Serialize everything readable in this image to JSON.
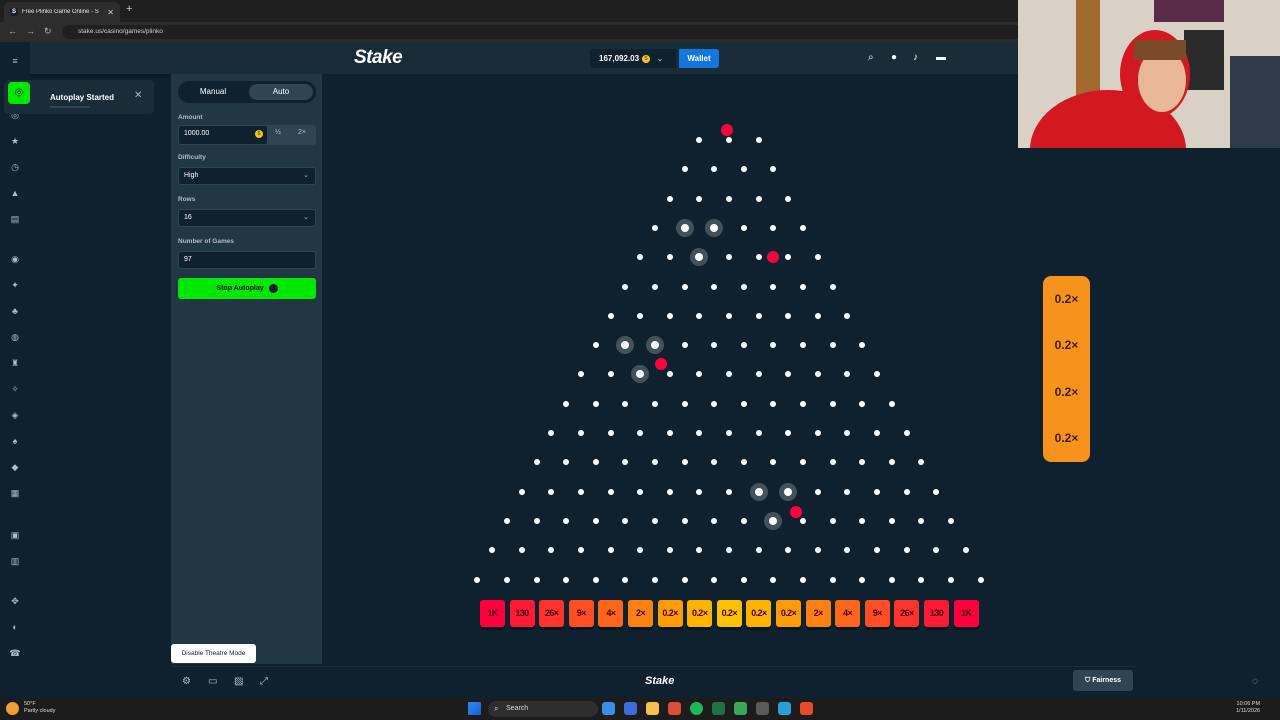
{
  "browser": {
    "tab_title": "Free Plinko Game Online - S",
    "url": "stake.us/casino/games/plinko"
  },
  "header": {
    "logo": "Stake",
    "balance": "167,092.03",
    "wallet_label": "Wallet"
  },
  "toast": {
    "text": "Autoplay Started"
  },
  "panel": {
    "tabs": [
      "Manual",
      "Auto"
    ],
    "active_tab": "Auto",
    "amount_label": "Amount",
    "amount_value": "1000.00",
    "half_label": "½",
    "double_label": "2×",
    "difficulty_label": "Difficulty",
    "difficulty_value": "High",
    "rows_label": "Rows",
    "rows_value": "16",
    "games_label": "Number of Games",
    "games_value": "97",
    "stop_label": "Stop Autoplay"
  },
  "board": {
    "rows": 16,
    "buckets": [
      "1K",
      "130",
      "26×",
      "9×",
      "4×",
      "2×",
      "0.2×",
      "0.2×",
      "0.2×",
      "0.2×",
      "0.2×",
      "2×",
      "4×",
      "9×",
      "26×",
      "130",
      "1K"
    ],
    "bucket_colors": [
      "#ff003f",
      "#ff1a36",
      "#ff332d",
      "#ff4d24",
      "#ff661b",
      "#ff8012",
      "#ff9a09",
      "#ffb300",
      "#ffc000",
      "#ffb300",
      "#ff9a09",
      "#ff8012",
      "#ff661b",
      "#ff4d24",
      "#ff332d",
      "#ff1a36",
      "#ff003f"
    ]
  },
  "history": [
    "0.2×",
    "0.2×",
    "0.2×",
    "0.2×"
  ],
  "history_color": "#f7931a",
  "footer": {
    "logo": "Stake",
    "fairness_label": "Fairness",
    "tooltip": "Disable Theatre Mode"
  },
  "taskbar": {
    "weather_temp": "50°F",
    "weather_desc": "Partly cloudy",
    "search_label": "Search",
    "time": "10:06 PM",
    "date": "1/11/2026"
  },
  "colors": {
    "accent_green": "#00e701",
    "wallet_blue": "#1475e1",
    "bg": "#0f212e",
    "panel": "#213743"
  }
}
